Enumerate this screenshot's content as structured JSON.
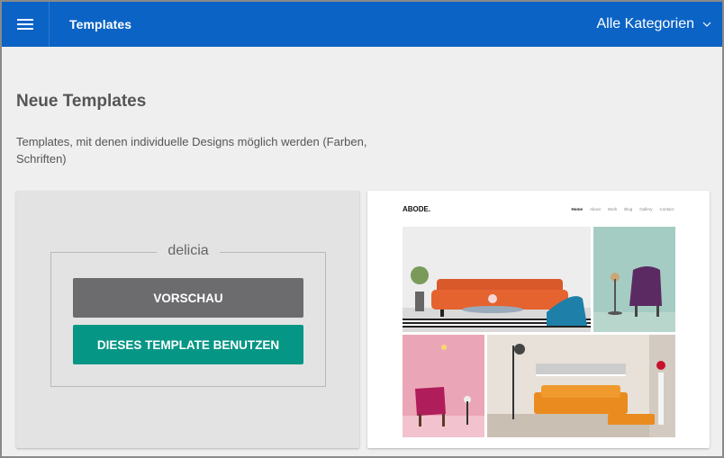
{
  "topbar": {
    "menu_icon": "hamburger-icon",
    "title": "Templates",
    "category_select": "Alle Kategorien",
    "chevron_icon": "chevron-down-icon",
    "bg_color": "#0b63c5"
  },
  "section": {
    "title": "Neue Templates",
    "description": "Templates, mit denen individuelle Designs möglich werden (Farben, Schriften)"
  },
  "template_card": {
    "name": "delicia",
    "preview_button": "VORSCHAU",
    "use_button": "DIESES TEMPLATE BENUTZEN",
    "preview_button_color": "#6c6c6f",
    "use_button_color": "#069685"
  },
  "template_preview": {
    "logo": "ABODE.",
    "nav": [
      "Home",
      "About",
      "Work",
      "Blog",
      "Gallery",
      "Contact"
    ]
  }
}
